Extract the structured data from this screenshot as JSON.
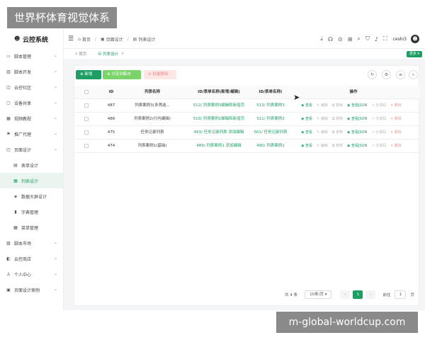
{
  "watermarks": {
    "top": "世界杯体育视觉体系",
    "bottom": "m-global-worldcup.com"
  },
  "app": {
    "name": "云控系统"
  },
  "sidebar": {
    "items": [
      {
        "label": "脚本管理",
        "icon": "folder-icon"
      },
      {
        "label": "脚本开发",
        "icon": "code-icon"
      },
      {
        "label": "云控社区",
        "icon": "community-icon"
      },
      {
        "label": "设备共享",
        "icon": "device-icon"
      },
      {
        "label": "视频教程",
        "icon": "video-icon"
      },
      {
        "label": "推广代理",
        "icon": "share-icon"
      },
      {
        "label": "页面设计",
        "icon": "design-icon"
      },
      {
        "label": "表单设计",
        "icon": "form-icon",
        "sub": true
      },
      {
        "label": "列表设计",
        "icon": "list-icon",
        "sub": true,
        "active": true
      },
      {
        "label": "数据大屏设计",
        "icon": "screen-icon",
        "sub": true
      },
      {
        "label": "字典管理",
        "icon": "dict-icon",
        "sub": true
      },
      {
        "label": "菜单管理",
        "icon": "menu-icon",
        "sub": true
      },
      {
        "label": "脚本市场",
        "icon": "market-icon"
      },
      {
        "label": "云控商店",
        "icon": "store-icon"
      },
      {
        "label": "个人中心",
        "icon": "user-icon"
      },
      {
        "label": "页面设计案例",
        "icon": "example-icon"
      }
    ]
  },
  "header": {
    "breadcrumb": [
      "首页",
      "页面设计",
      "列表设计"
    ],
    "user": "ceshi3"
  },
  "tabs": [
    {
      "label": "首页",
      "active": false
    },
    {
      "label": "列表设计",
      "active": true
    }
  ],
  "more_label": "更多",
  "toolbar": {
    "add": "新增",
    "share": "分享到集市",
    "delete": "批量删除"
  },
  "table": {
    "headers": [
      "ID",
      "列表名称",
      "ID/表单名称(新增/编辑)",
      "ID/表单名称(",
      "操作"
    ],
    "rows": [
      {
        "id": "487",
        "name": "列表案例3(多筛选...",
        "form": "512/ 列表案例3编辑和新增页",
        "list": "513/ 列表案例3",
        "active_ops": 4
      },
      {
        "id": "486",
        "name": "列表案例2(行内编辑)",
        "form": "510/ 列表案例2编辑和新增页",
        "list": "511/ 列表案例2",
        "active_ops": 4
      },
      {
        "id": "475",
        "name": "任务记录列表",
        "form": "493/ 任务记录列表 添加编辑",
        "list": "501/ 任务记录列表",
        "active_ops": 4
      },
      {
        "id": "474",
        "name": "列表案例1(基础)",
        "form": "489/ 列表案例1 添加编辑",
        "list": "490/ 列表案例1",
        "active_ops": 4
      }
    ],
    "ops": [
      "查看",
      "编辑",
      "复制",
      "查看JSON",
      "分享码",
      "删除"
    ]
  },
  "pagination": {
    "total": "共 4 条",
    "per_page": "10条/页",
    "current": "1",
    "goto_label": "前往",
    "goto_value": "1",
    "page_unit": "页"
  },
  "colors": {
    "primary": "#1e9e64",
    "share": "#7bd46a",
    "danger_bg": "#fde6e6"
  }
}
